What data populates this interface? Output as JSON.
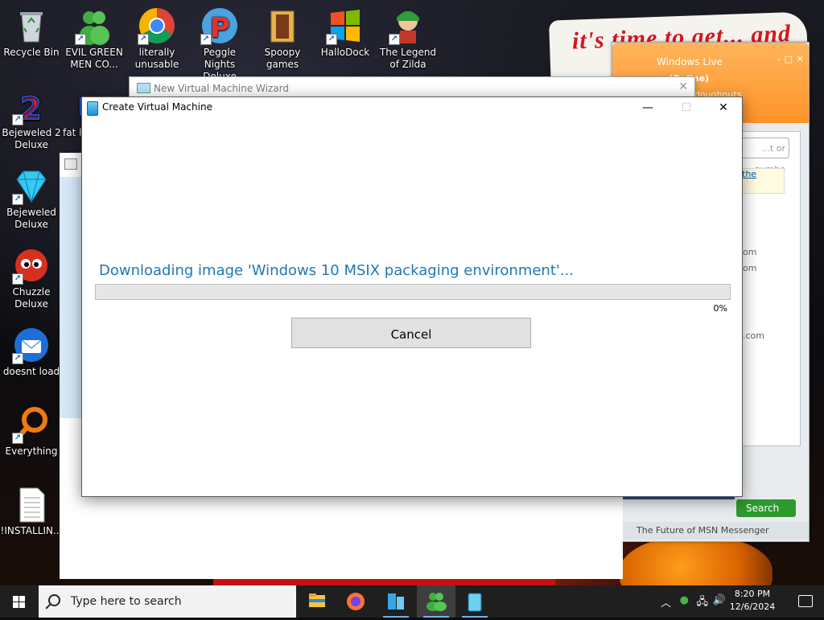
{
  "desktop": {
    "wallpaper_text": "it's time to get... and",
    "icons": [
      {
        "label": "Recycle Bin",
        "icon": "recycle-bin-icon"
      },
      {
        "label": "EVIL GREEN MEN CO...",
        "icon": "green-men-icon"
      },
      {
        "label": "literally unusable",
        "icon": "chrome-icon"
      },
      {
        "label": "Peggle Nights Deluxe",
        "icon": "peggle-icon"
      },
      {
        "label": "Spoopy games",
        "icon": "folder-icon"
      },
      {
        "label": "HalloDock",
        "icon": "windows-logo-icon"
      },
      {
        "label": "The Legend of Zilda",
        "icon": "zilda-icon"
      },
      {
        "label": "Bejeweled 2 Deluxe",
        "icon": "bejeweled2-icon"
      },
      {
        "label": "fat l...",
        "icon": "fat-icon"
      },
      {
        "label": "Bejeweled Deluxe",
        "icon": "diamond-icon"
      },
      {
        "label": "Chuzzle Deluxe",
        "icon": "chuzzle-icon"
      },
      {
        "label": "doesnt load",
        "icon": "thunderbird-icon"
      },
      {
        "label": "Everything",
        "icon": "everything-search-icon"
      },
      {
        "label": "!INSTALLIN...",
        "icon": "text-file-icon"
      }
    ]
  },
  "msn": {
    "title": "Windows Live",
    "status": "(Online)",
    "personal_message": "...ate doughnuts",
    "search_placeholder": "...t or numbe",
    "link_text": "the",
    "list_fragments": [
      "om",
      "om",
      ".com"
    ],
    "search_button": "Search",
    "footer": "The Future of MSN Messenger"
  },
  "wizard": {
    "title": "New Virtual Machine Wizard"
  },
  "dialog": {
    "title": "Create Virtual Machine",
    "status_text": "Downloading image 'Windows 10 MSIX packaging environment'...",
    "progress_label": "0%",
    "progress_value": 0,
    "cancel_label": "Cancel"
  },
  "taskbar": {
    "search_placeholder": "Type here to search",
    "apps": [
      "file-explorer-icon",
      "firefox-icon",
      "hyperv-manager-icon",
      "msn-messenger-icon",
      "virtual-machine-icon"
    ],
    "time": "8:20 PM",
    "date": "12/6/2024"
  },
  "colors": {
    "accent_text": "#1f78b4",
    "progress_green": "#06b025",
    "taskbar_bg": "#1f1f1f",
    "msn_orange": "#ff9326"
  }
}
